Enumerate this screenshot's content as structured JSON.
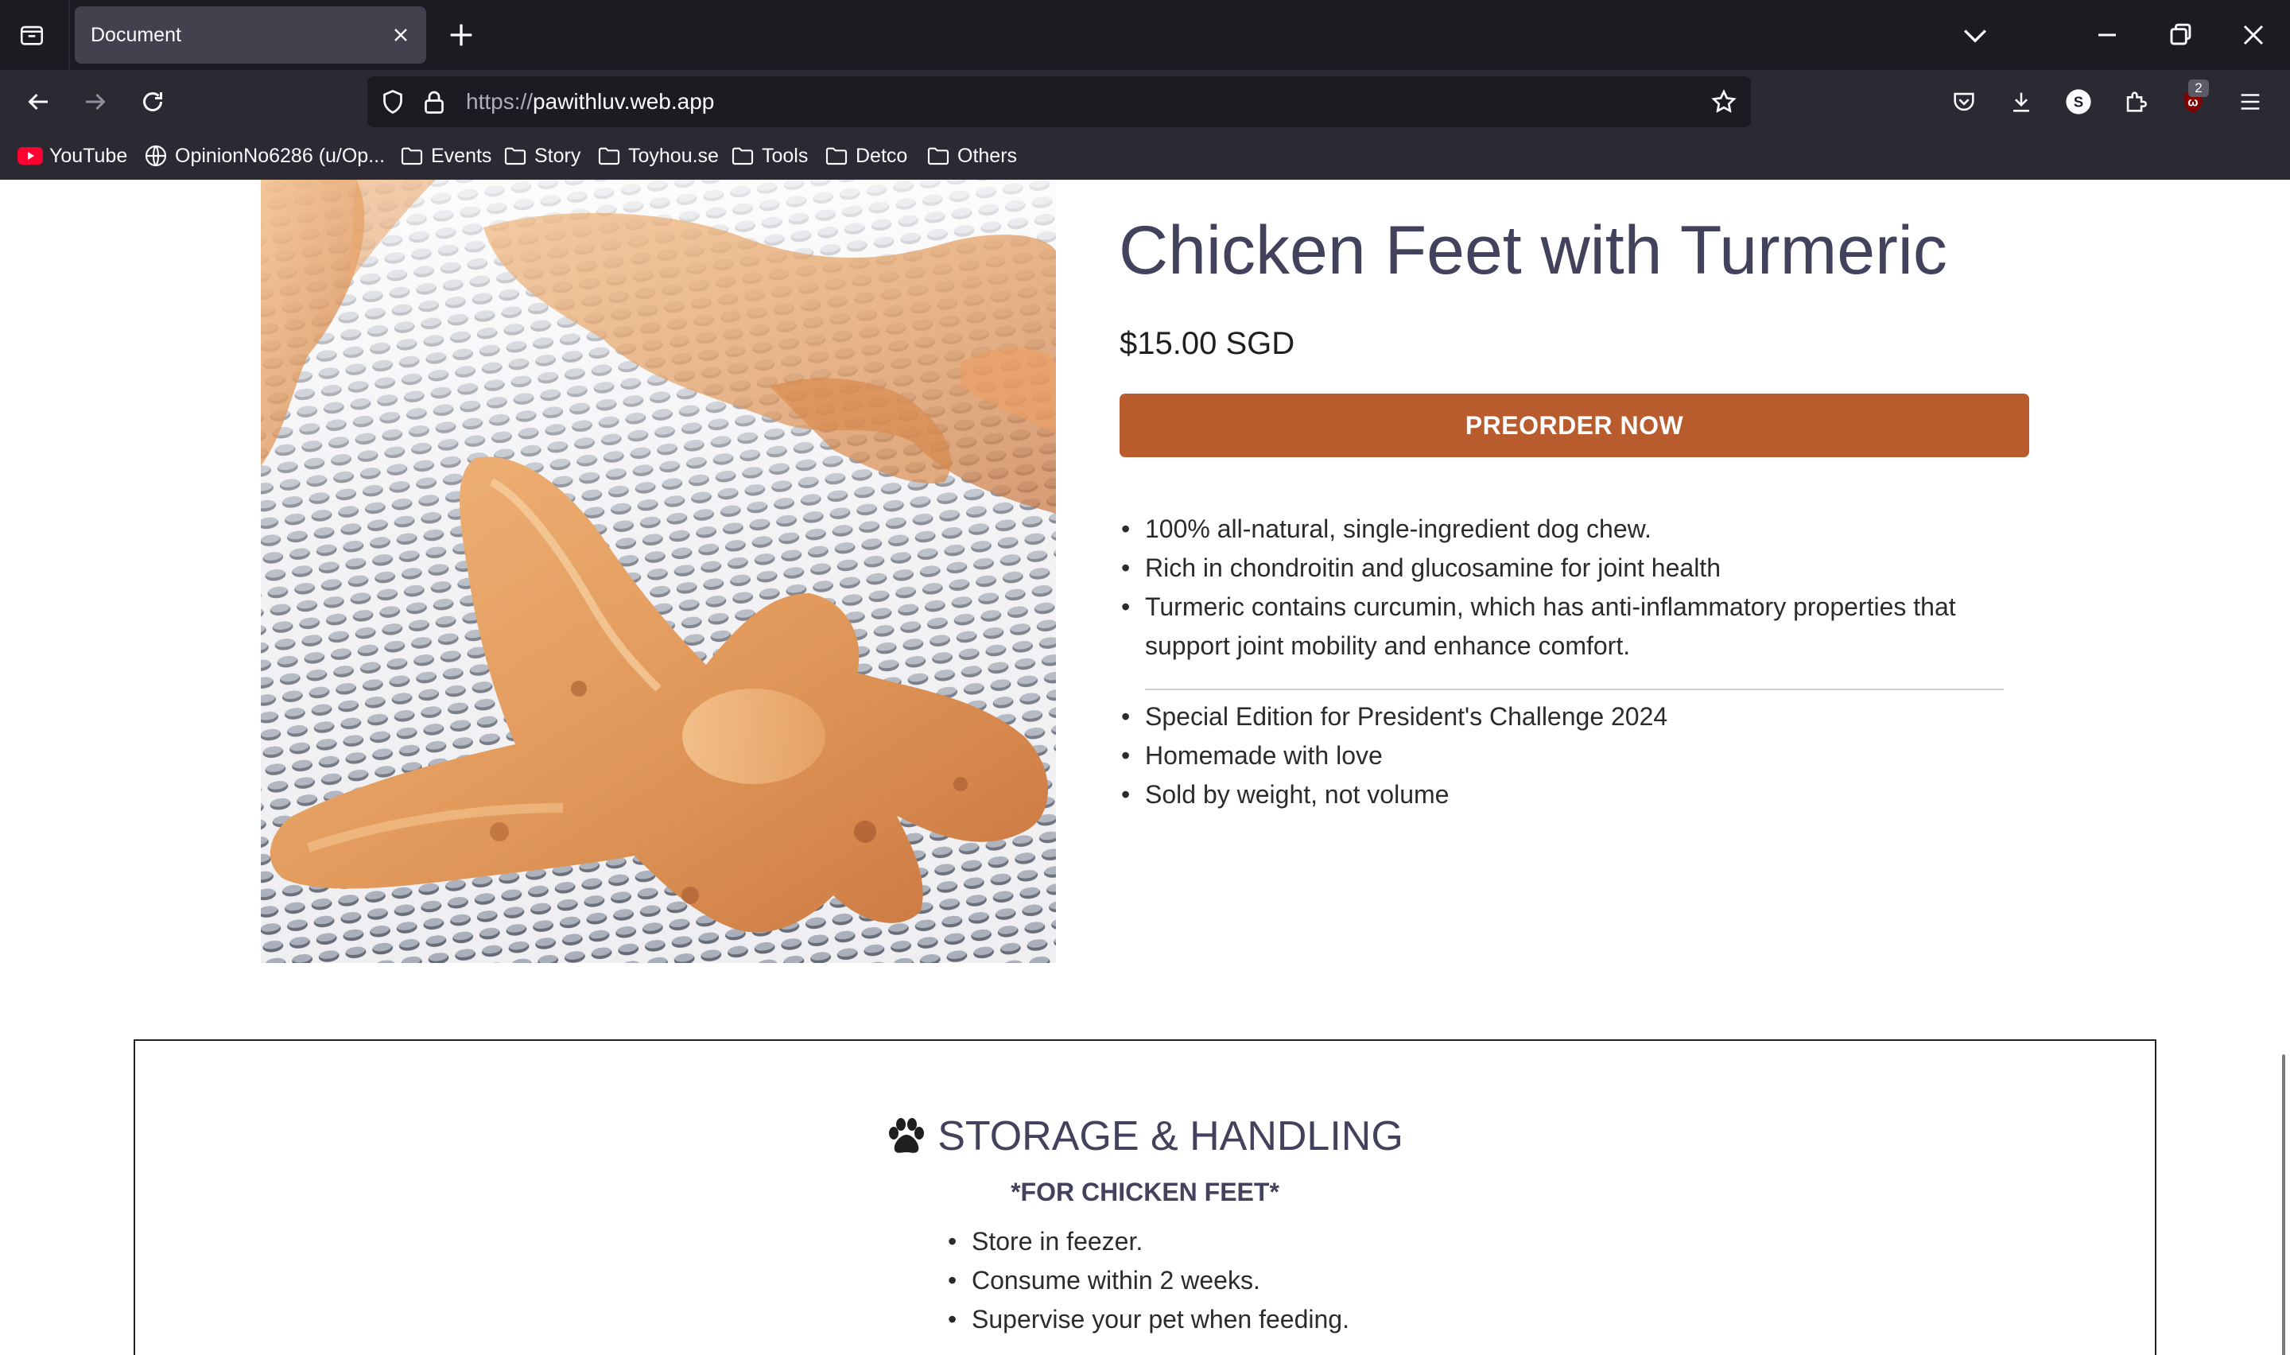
{
  "browser": {
    "tab": {
      "title": "Document"
    },
    "url": {
      "protocol": "https://",
      "host": "pawithluv.web.app"
    },
    "extension_badge": "2",
    "account_initial": "S"
  },
  "bookmarks": [
    {
      "label": "YouTube",
      "icon": "youtube-icon"
    },
    {
      "label": "OpinionNo6286 (u/Op...",
      "icon": "globe-icon"
    },
    {
      "label": "Events",
      "icon": "folder-icon"
    },
    {
      "label": "Story",
      "icon": "folder-icon"
    },
    {
      "label": "Toyhou.se",
      "icon": "folder-icon"
    },
    {
      "label": "Tools",
      "icon": "folder-icon"
    },
    {
      "label": "Detco",
      "icon": "folder-icon"
    },
    {
      "label": "Others",
      "icon": "folder-icon"
    }
  ],
  "product": {
    "title": "Chicken Feet with Turmeric",
    "price": "$15.00 SGD",
    "cta_label": "PREORDER NOW",
    "features": [
      "100% all-natural, single-ingredient dog chew.",
      "Rich in chondroitin and glucosamine for joint health",
      "Turmeric contains curcumin, which has anti-inflammatory properties that support joint mobility and enhance comfort."
    ],
    "highlights": [
      "Special Edition for President's Challenge 2024",
      "Homemade with love",
      "Sold by weight, not volume"
    ]
  },
  "storage": {
    "heading": "STORAGE & HANDLING",
    "subheading": "*FOR CHICKEN FEET*",
    "items": [
      "Store in feezer.",
      "Consume within 2 weeks.",
      "Supervise your pet when feeding."
    ]
  },
  "colors": {
    "accent": "#b85c2e",
    "heading": "#43425d",
    "chrome_dark": "#1c1b22",
    "chrome": "#2b2a33"
  }
}
